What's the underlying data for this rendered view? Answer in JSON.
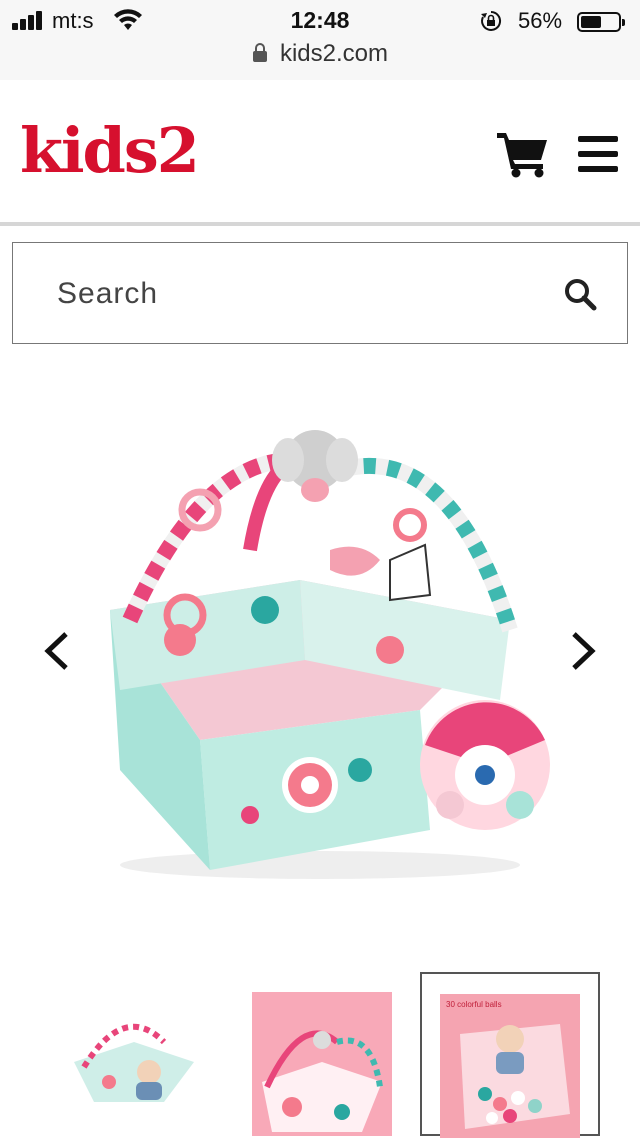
{
  "status_bar": {
    "carrier": "mt:s",
    "time": "12:48",
    "battery_percent": "56%",
    "battery_level": 0.56,
    "url": "kids2.com"
  },
  "header": {
    "logo_text": "kids2",
    "cart_icon": "cart-icon",
    "menu_icon": "hamburger-menu-icon"
  },
  "search": {
    "placeholder": "Search",
    "icon": "search-icon"
  },
  "gallery": {
    "prev_icon": "chevron-left-icon",
    "next_icon": "chevron-right-icon",
    "thumbnails": [
      {
        "selected": false
      },
      {
        "selected": false
      },
      {
        "selected": true,
        "caption": "30 colorful balls"
      }
    ]
  },
  "colors": {
    "brand_red": "#d6102e",
    "pink": "#e8457a",
    "mint": "#9fe0d6"
  }
}
